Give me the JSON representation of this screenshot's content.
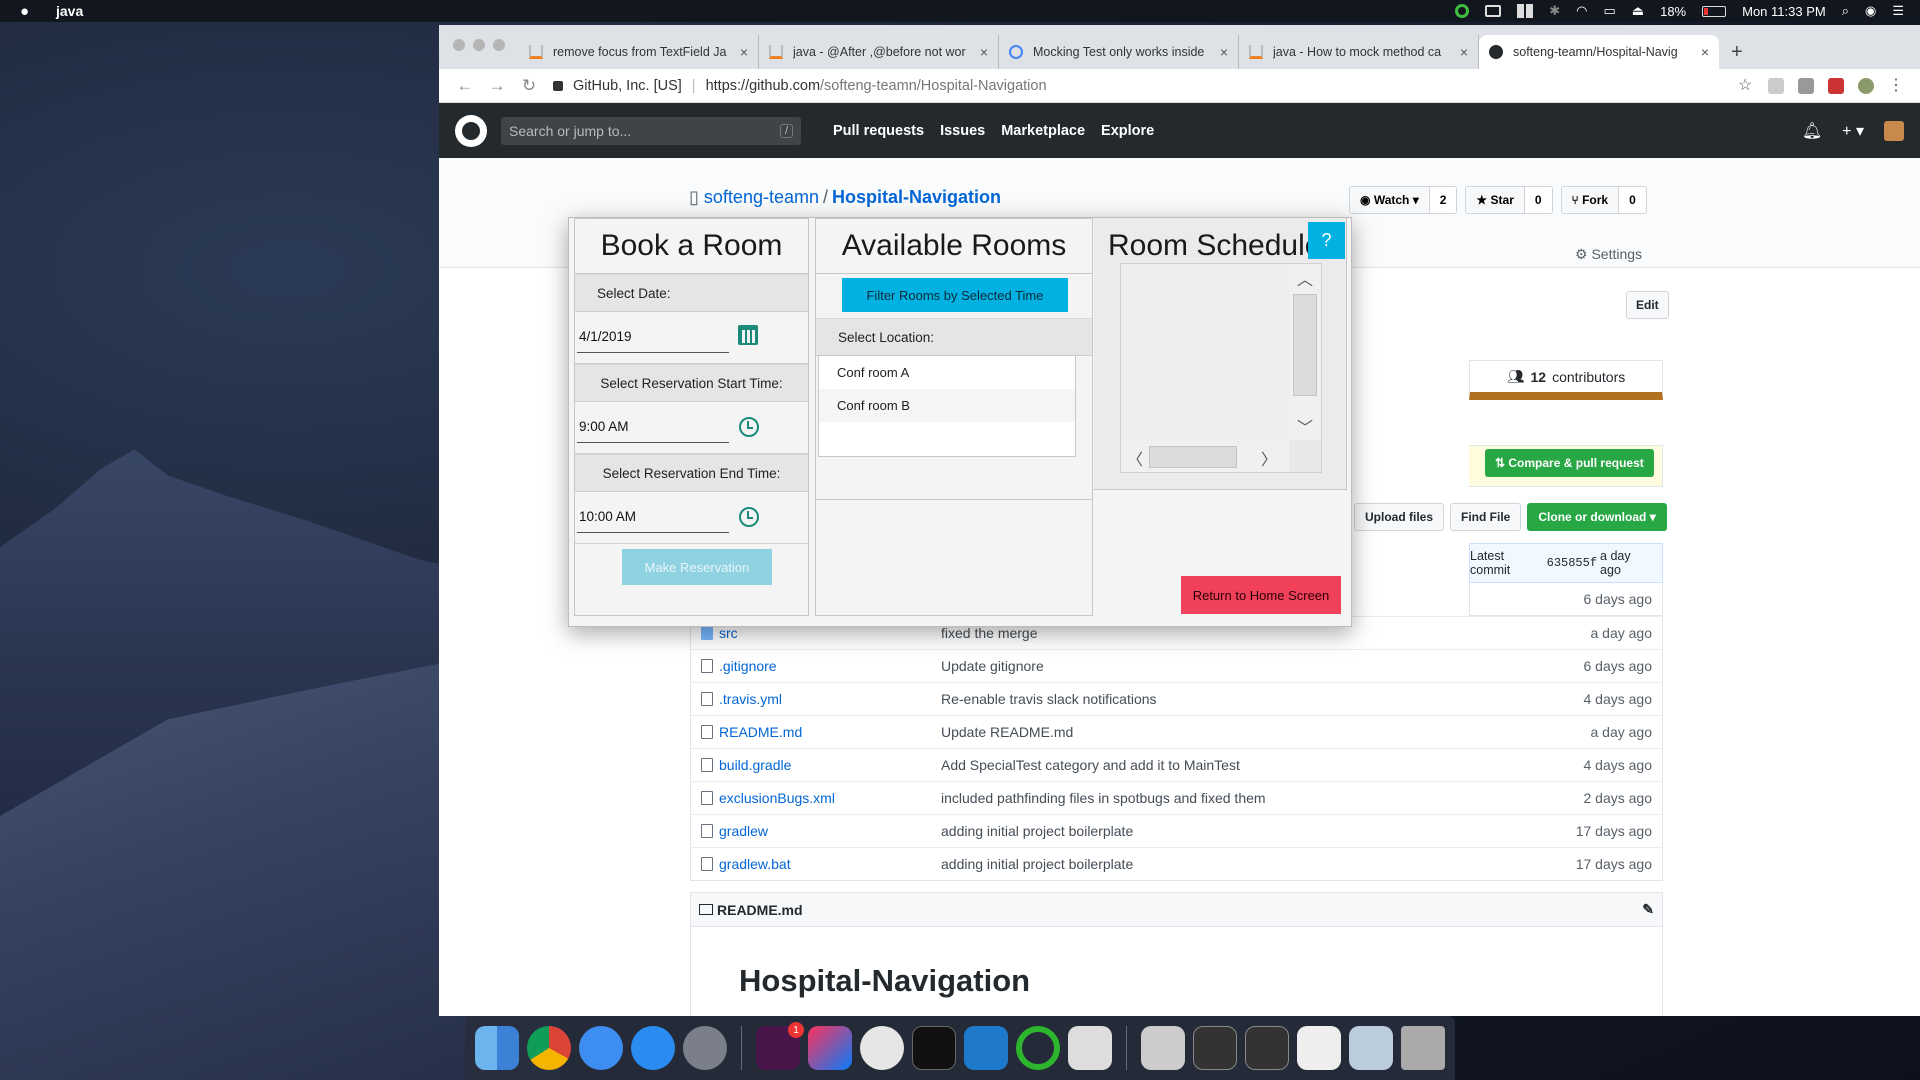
{
  "menubar": {
    "app_name": "java",
    "battery": "18%",
    "clock": "Mon 11:33 PM"
  },
  "browser": {
    "tabs": [
      {
        "title": "remove focus from TextField Ja"
      },
      {
        "title": "java - @After ,@before not wor"
      },
      {
        "title": "Mocking Test only works inside"
      },
      {
        "title": "java - How to mock method ca"
      },
      {
        "title": "softeng-teamn/Hospital-Navig"
      }
    ],
    "new_tab": "+",
    "site_org": "GitHub, Inc. [US]",
    "url_host": "https://github.com",
    "url_path": "/softeng-teamn/Hospital-Navigation"
  },
  "github": {
    "search_placeholder": "Search or jump to...",
    "search_key": "/",
    "nav": [
      "Pull requests",
      "Issues",
      "Marketplace",
      "Explore"
    ],
    "owner": "softeng-teamn",
    "repo": "Hospital-Navigation",
    "watch_label": "Watch",
    "watch_count": "2",
    "star_label": "Star",
    "star_count": "0",
    "fork_label": "Fork",
    "fork_count": "0",
    "settings_label": "Settings",
    "edit_label": "Edit",
    "contributors_count": "12",
    "contributors_label": "contributors",
    "compare_label": "Compare & pull request",
    "upload_label": "Upload files",
    "find_label": "Find File",
    "clone_label": "Clone or download",
    "latest_commit_prefix": "Latest commit",
    "latest_commit_hash": "635855f",
    "latest_commit_age": "a day ago",
    "first_row_age": "6 days ago",
    "files": [
      {
        "name": "src",
        "message": "fixed the merge",
        "age": "a day ago",
        "folder": true
      },
      {
        "name": ".gitignore",
        "message": "Update gitignore",
        "age": "6 days ago"
      },
      {
        "name": ".travis.yml",
        "message": "Re-enable travis slack notifications",
        "age": "4 days ago"
      },
      {
        "name": "README.md",
        "message": "Update README.md",
        "age": "a day ago"
      },
      {
        "name": "build.gradle",
        "message": "Add SpecialTest category and add it to MainTest",
        "age": "4 days ago"
      },
      {
        "name": "exclusionBugs.xml",
        "message": "included pathfinding files in spotbugs and fixed them",
        "age": "2 days ago"
      },
      {
        "name": "gradlew",
        "message": "adding initial project boilerplate",
        "age": "17 days ago"
      },
      {
        "name": "gradlew.bat",
        "message": "adding initial project boilerplate",
        "age": "17 days ago"
      }
    ],
    "readme_title": "README.md",
    "readme_h1": "Hospital-Navigation"
  },
  "app": {
    "book_title": "Book a Room",
    "date_label": "Select Date:",
    "date_value": "4/1/2019",
    "start_label": "Select Reservation Start Time:",
    "start_value": "9:00 AM",
    "end_label": "Select Reservation End Time:",
    "end_value": "10:00 AM",
    "make_reservation": "Make Reservation",
    "available_title": "Available Rooms",
    "filter_button": "Filter Rooms by Selected Time",
    "location_label": "Select Location:",
    "locations": [
      "Conf room A",
      "Conf room B"
    ],
    "schedule_title": "Room Schedule",
    "help_button": "?",
    "return_button": "Return to Home Screen"
  }
}
